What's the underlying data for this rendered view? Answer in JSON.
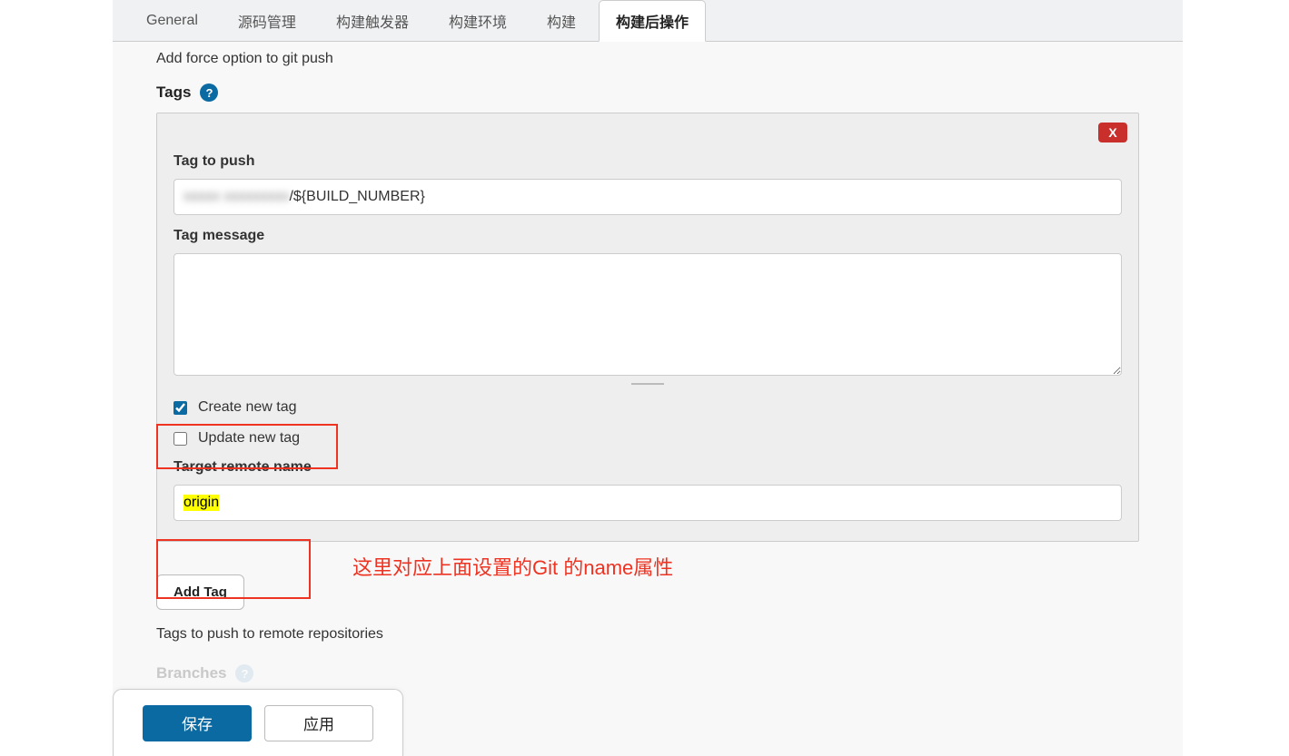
{
  "tabs": {
    "general": "General",
    "scm": "源码管理",
    "triggers": "构建触发器",
    "env": "构建环境",
    "build": "构建",
    "postbuild": "构建后操作"
  },
  "content": {
    "force_option_note": "Add force option to git push",
    "tags_heading": "Tags",
    "card_close": "X",
    "tag_to_push_label": "Tag to push",
    "tag_to_push_prefix": "xxxxx xxxxxxxxx",
    "tag_to_push_value": "/${BUILD_NUMBER}",
    "tag_message_label": "Tag message",
    "tag_message_value": "",
    "create_new_tag_label": "Create new tag",
    "create_new_tag_checked": true,
    "update_new_tag_label": "Update new tag",
    "update_new_tag_checked": false,
    "target_remote_label": "Target remote name",
    "target_remote_value": "origin",
    "add_tag_button": "Add Tag",
    "tags_subtext": "Tags to push to remote repositories",
    "branches_heading": "Branches"
  },
  "annotations": {
    "remote_hint": "这里对应上面设置的Git 的name属性"
  },
  "footer": {
    "save": "保存",
    "apply": "应用"
  }
}
